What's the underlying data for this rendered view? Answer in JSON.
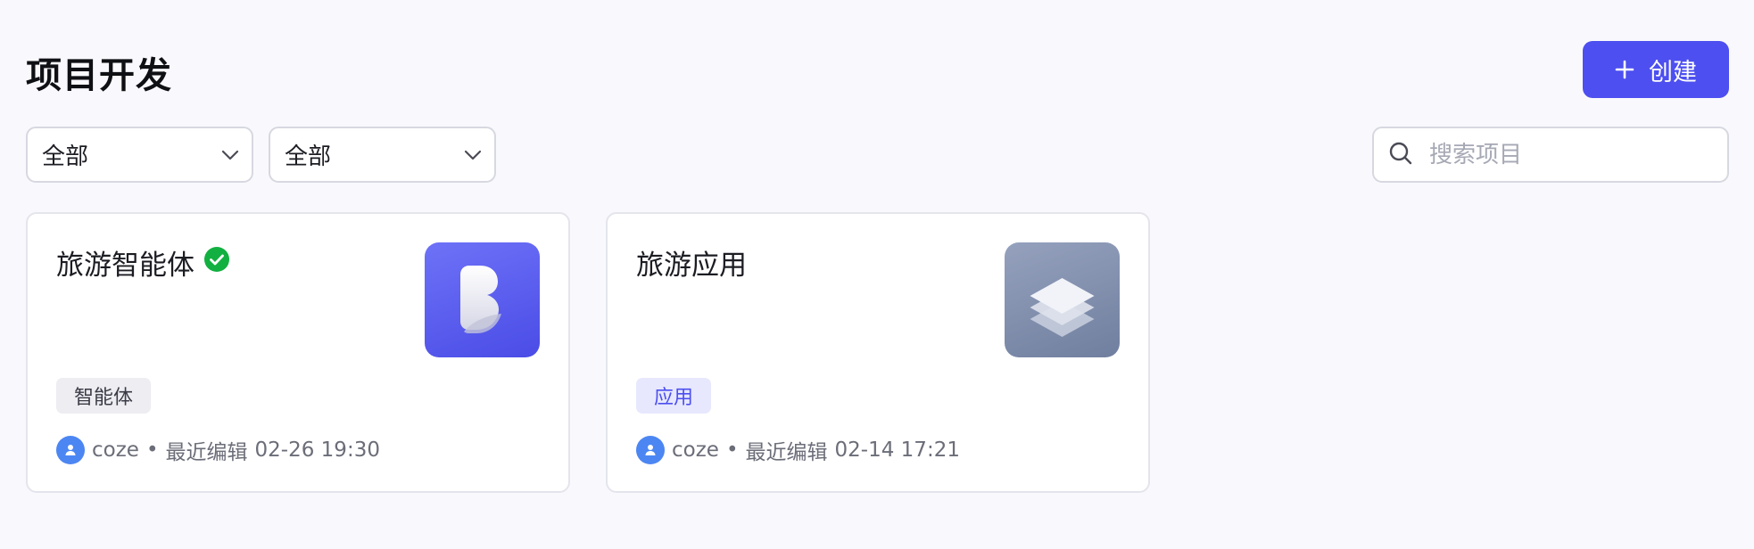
{
  "page": {
    "title": "项目开发"
  },
  "toolbar": {
    "create_label": "创建",
    "create_icon": "plus-icon"
  },
  "filters": [
    {
      "value": "全部",
      "icon": "chevron-down-icon"
    },
    {
      "value": "全部",
      "icon": "chevron-down-icon"
    }
  ],
  "search": {
    "placeholder": "搜索项目",
    "value": "",
    "icon": "search-icon"
  },
  "projects": [
    {
      "title": "旅游智能体",
      "status_icon": "check-circle-icon",
      "status_color": "#12b040",
      "tag": "智能体",
      "owner": "coze",
      "separator": "•",
      "edited_label": "最近编辑",
      "edited_time": "02-26 19:30",
      "thumbnail_icon": "agent-logo-icon"
    },
    {
      "title": "旅游应用",
      "tag": "应用",
      "owner": "coze",
      "separator": "•",
      "edited_label": "最近编辑",
      "edited_time": "02-14 17:21",
      "thumbnail_icon": "layers-icon"
    }
  ],
  "colors": {
    "accent": "#4d4ff0",
    "background": "#f9f9fd",
    "avatar": "#4c86f2",
    "app_tag_text": "#4d4ff0"
  }
}
